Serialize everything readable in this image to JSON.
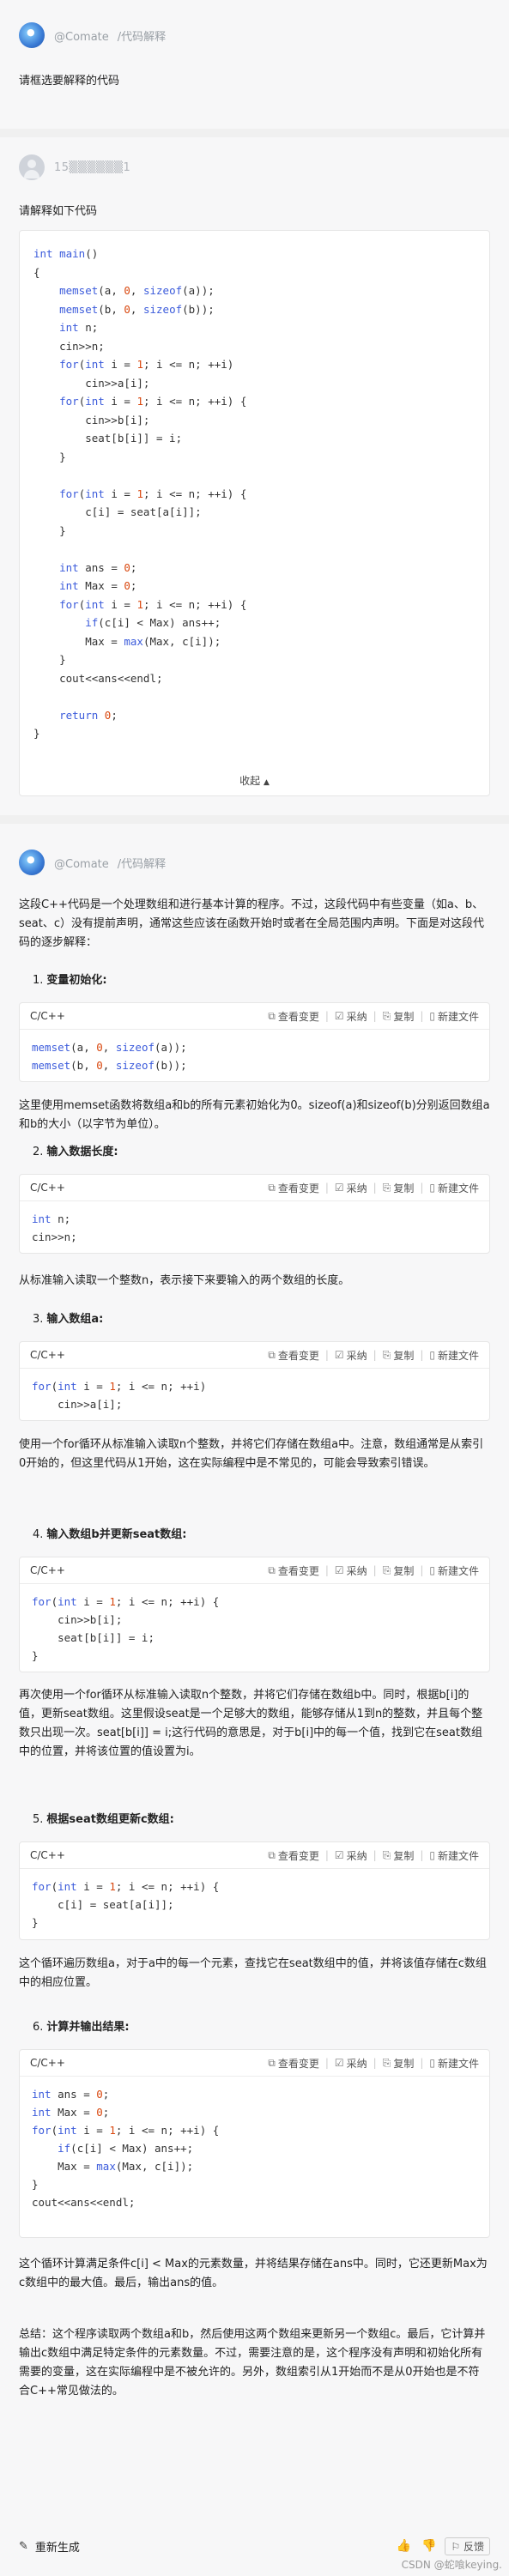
{
  "bot_label": "@Comate",
  "bot_subtitle": "/代码解释",
  "prompt1": "请框选要解释的代码",
  "user_name": "15▒▒▒▒▒▒1",
  "prompt2": "请解释如下代码",
  "fold_label": "收起",
  "fold_icon": "▲",
  "answer": {
    "intro": "这段C++代码是一个处理数组和进行基本计算的程序。不过，这段代码中有些变量（如a、b、seat、c）没有提前声明，通常这些应该在函数开始时或者在全局范围内声明。下面是对这段代码的逐步解释：",
    "toolbar": {
      "lang": "C/C++",
      "view_changes": "查看变更",
      "accept": "采纳",
      "copy": "复制",
      "new_file": "新建文件"
    },
    "steps": [
      {
        "num": "1.",
        "title": "变量初始化:"
      },
      {
        "num": "2.",
        "title": "输入数据长度:"
      },
      {
        "num": "3.",
        "title": "输入数组a:"
      },
      {
        "num": "4.",
        "title": "输入数组b并更新seat数组:"
      },
      {
        "num": "5.",
        "title": "根据seat数组更新c数组:"
      },
      {
        "num": "6.",
        "title": "计算并输出结果:"
      }
    ],
    "p1": "这里使用memset函数将数组a和b的所有元素初始化为0。sizeof(a)和sizeof(b)分别返回数组a和b的大小（以字节为单位）。",
    "p2": "从标准输入读取一个整数n，表示接下来要输入的两个数组的长度。",
    "p3": "使用一个for循环从标准输入读取n个整数，并将它们存储在数组a中。注意，数组通常是从索引0开始的，但这里代码从1开始，这在实际编程中是不常见的，可能会导致索引错误。",
    "p4": "再次使用一个for循环从标准输入读取n个整数，并将它们存储在数组b中。同时，根据b[i]的值，更新seat数组。这里假设seat是一个足够大的数组，能够存储从1到n的整数，并且每个整数只出现一次。seat[b[i]] = i;这行代码的意思是，对于b[i]中的每一个值，找到它在seat数组中的位置，并将该位置的值设置为i。",
    "p5": "这个循环遍历数组a，对于a中的每一个元素，查找它在seat数组中的值，并将该值存储在c数组中的相应位置。",
    "p6": "这个循环计算满足条件c[i] < Max的元素数量，并将结果存储在ans中。同时，它还更新Max为c数组中的最大值。最后，输出ans的值。",
    "summary": "总结：这个程序读取两个数组a和b，然后使用这两个数组来更新另一个数组c。最后，它计算并输出c数组中满足特定条件的元素数量。不过，需要注意的是，这个程序没有声明和初始化所有需要的变量，这在实际编程中是不被允许的。另外，数组索引从1开始而不是从0开始也是不符合C++常见做法的。"
  },
  "footer": {
    "regenerate": "重新生成",
    "like_icon": "thumbs-up",
    "dislike_icon": "thumbs-down",
    "feedback": "反馈"
  },
  "watermark": "CSDN @蛇喰keying."
}
